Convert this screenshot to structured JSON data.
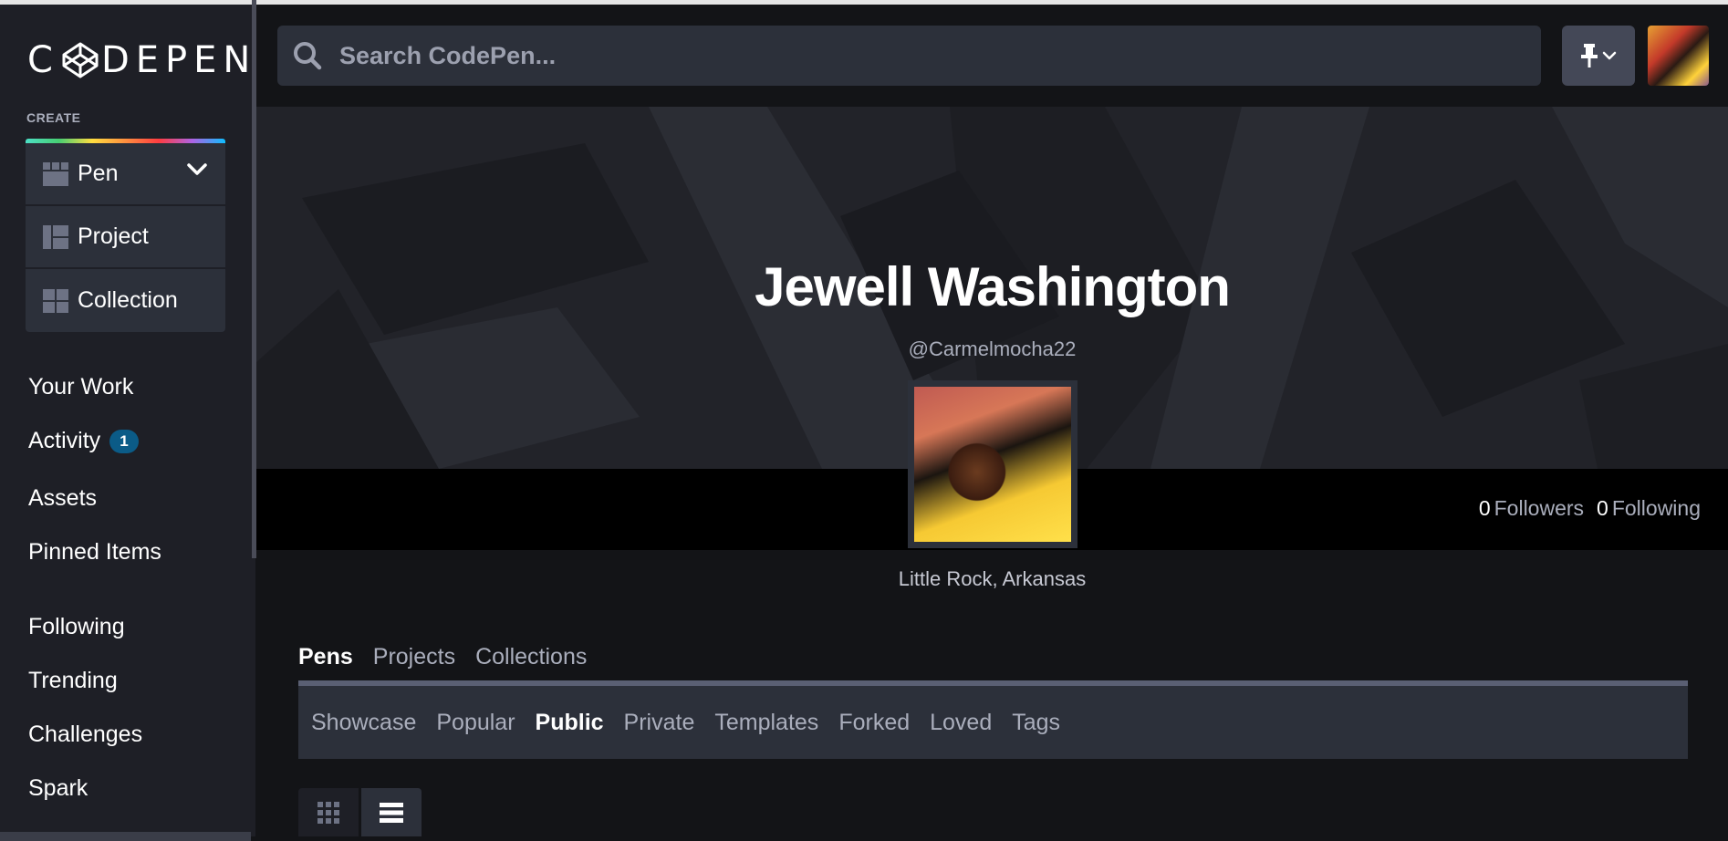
{
  "app": {
    "logo_text": "CODEPEN",
    "create_label": "CREATE"
  },
  "create_items": [
    {
      "label": "Pen",
      "icon": "pen-grid-icon"
    },
    {
      "label": "Project",
      "icon": "project-icon"
    },
    {
      "label": "Collection",
      "icon": "collection-grid-icon"
    }
  ],
  "nav": {
    "your_work": "Your Work",
    "activity": "Activity",
    "activity_badge": "1",
    "assets": "Assets",
    "pinned_items": "Pinned Items",
    "following": "Following",
    "trending": "Trending",
    "challenges": "Challenges",
    "spark": "Spark"
  },
  "search": {
    "placeholder": "Search CodePen..."
  },
  "profile": {
    "name": "Jewell Washington",
    "handle": "@Carmelmocha22",
    "location": "Little Rock, Arkansas",
    "followers_count": "0",
    "followers_label": "Followers",
    "following_count": "0",
    "following_label": "Following"
  },
  "tabs": [
    "Pens",
    "Projects",
    "Collections"
  ],
  "active_tab": "Pens",
  "subtabs": [
    "Showcase",
    "Popular",
    "Public",
    "Private",
    "Templates",
    "Forked",
    "Loved",
    "Tags"
  ],
  "active_subtab": "Public",
  "colors": {
    "background": "#131417",
    "sidebar": "#1e1f26",
    "panel": "#2c303a",
    "badge": "#0b5b87",
    "muted_text": "#aaaebc"
  }
}
